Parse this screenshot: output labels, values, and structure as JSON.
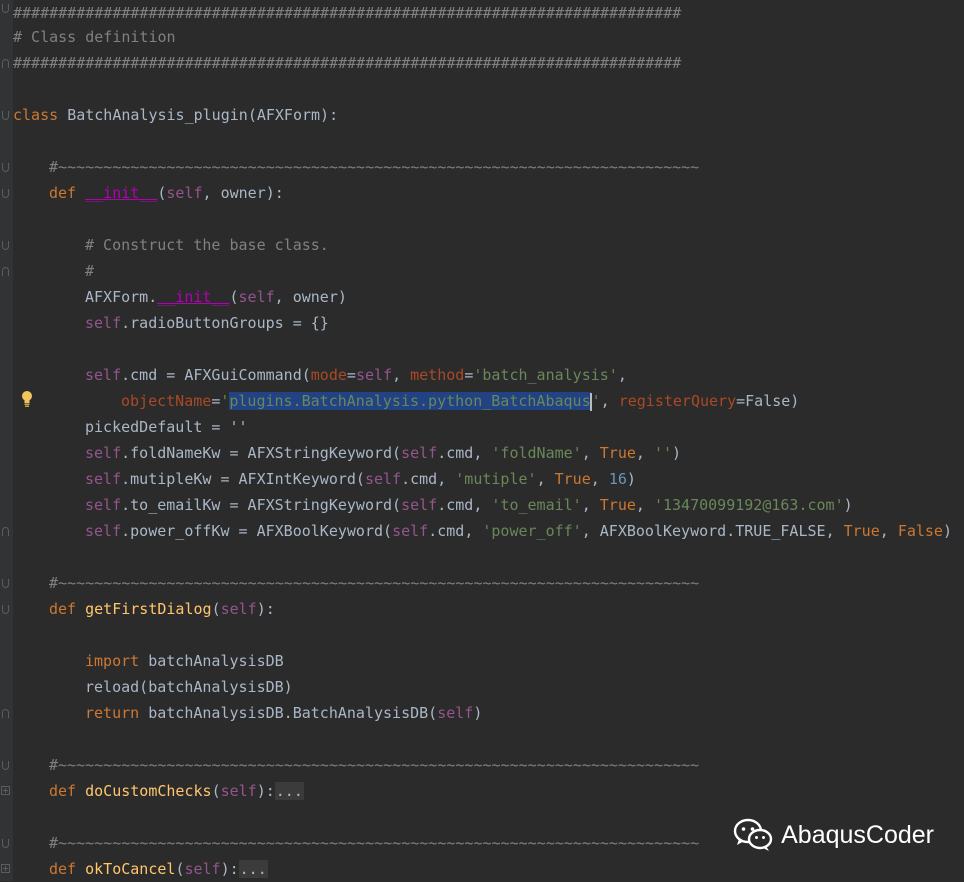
{
  "code": {
    "hash_line": "##########################################################################",
    "section_comment": "# Class definition",
    "class_kw": "class",
    "class_name": "BatchAnalysis_plugin",
    "class_base": "(AFXForm):",
    "sep_comment": "#~~~~~~~~~~~~~~~~~~~~~~~~~~~~~~~~~~~~~~~~~~~~~~~~~~~~~~~~~~~~~~~~~~~~~~~",
    "def_kw": "def",
    "init_name": "__init__",
    "init_sig_open": "(",
    "self": "self",
    "init_sig_rest": ", owner):",
    "comment_construct": "# Construct the base class.",
    "comment_hash": "#",
    "afxform_call_a": "AFXForm.",
    "afxform_call_b": "(",
    "afxform_call_c": ", owner)",
    "radio_rest": ".radioButtonGroups = {}",
    "cmd_a": ".cmd = AFXGuiCommand(",
    "mode_param": "mode",
    "cmd_b": "=",
    "cmd_c": ", ",
    "method_param": "method",
    "method_str": "'batch_analysis'",
    "comma": ",",
    "objname_param": "objectName",
    "objname_quote_open": "'",
    "objname_value": "plugins.BatchAnalysis.python_BatchAbaqus",
    "objname_quote_close": "'",
    "regq_param": "registerQuery",
    "regq_rest": "=False)",
    "picked_default": "pickedDefault = ''",
    "fold_a": ".foldNameKw = AFXStringKeyword(",
    "fold_str": "'foldName'",
    "true_kw": "True",
    "empty_str": "''",
    "mut_a": ".mutipleKw = AFXIntKeyword(",
    "mut_str": "'mutiple'",
    "mut_num": "16",
    "email_a": ".to_emailKw = AFXStringKeyword(",
    "email_str": "'to_email'",
    "email_val": "'13470099192@163.com'",
    "power_a": ".power_offKw = AFXBoolKeyword(",
    "power_str": "'power_off'",
    "power_b": "AFXBoolKeyword.TRUE_FALSE",
    "false_kw": "False",
    "get_first_dialog": "getFirstDialog",
    "import_kw": "import",
    "import_mod": " batchAnalysisDB",
    "reload_line": "reload(batchAnalysisDB)",
    "return_kw": "return",
    "return_rest": " batchAnalysisDB.BatchAnalysisDB(",
    "do_custom_checks": "doCustomChecks",
    "ok_to_cancel": "okToCancel",
    "collapsed": "...",
    "cmd_dot": ".cmd",
    "close_paren": ")",
    "open_paren": "(",
    "paren_self_colon": "):"
  },
  "watermark": {
    "text": "AbaqusCoder",
    "icon": "wechat-icon"
  },
  "colors": {
    "background": "#2b2b2b",
    "comment": "#808080",
    "keyword": "#cc7832",
    "self": "#94558d",
    "function": "#ffc66d",
    "string": "#6a8759",
    "number": "#6897bb",
    "selection": "#214283"
  }
}
